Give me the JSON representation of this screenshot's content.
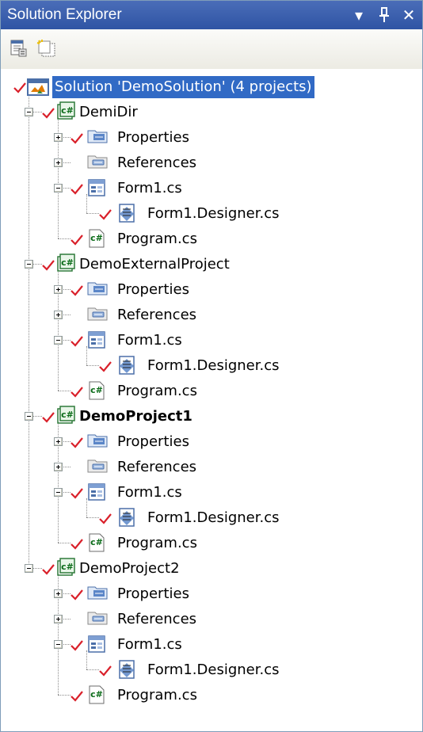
{
  "window": {
    "title": "Solution Explorer",
    "buttons": [
      {
        "name": "dropdown",
        "glyph": "▾"
      },
      {
        "name": "autohide-pin",
        "glyph": "ᵻ"
      },
      {
        "name": "close",
        "glyph": "✕"
      }
    ]
  },
  "toolbar": {
    "buttons": [
      {
        "name": "properties-button"
      },
      {
        "name": "show-all-files-button"
      }
    ]
  },
  "colors": {
    "selection": "#316ac5",
    "check": "#d9202a",
    "titlebar": "#3a5fae"
  },
  "tree": {
    "items": [
      {
        "label": "Solution 'DemoSolution' (4 projects)",
        "level": 0,
        "icon": "solution-icon",
        "expander": "none",
        "checked": true,
        "selected": true,
        "bold": false
      },
      {
        "label": "DemiDir",
        "level": 1,
        "icon": "csharp-project-icon",
        "expander": "minus",
        "checked": true,
        "bold": false
      },
      {
        "label": "Properties",
        "level": 2,
        "icon": "properties-icon",
        "expander": "plus",
        "checked": true
      },
      {
        "label": "References",
        "level": 2,
        "icon": "references-icon",
        "expander": "plus",
        "checked": false
      },
      {
        "label": "Form1.cs",
        "level": 2,
        "icon": "form-icon",
        "expander": "minus",
        "checked": true
      },
      {
        "label": "Form1.Designer.cs",
        "level": 3,
        "icon": "designer-icon",
        "expander": "none",
        "checked": true
      },
      {
        "label": "Program.cs",
        "level": 2,
        "icon": "csharp-file-icon",
        "expander": "none",
        "checked": true
      },
      {
        "label": "DemoExternalProject",
        "level": 1,
        "icon": "csharp-project-icon",
        "expander": "minus",
        "checked": true,
        "bold": false
      },
      {
        "label": "Properties",
        "level": 2,
        "icon": "properties-icon",
        "expander": "plus",
        "checked": true
      },
      {
        "label": "References",
        "level": 2,
        "icon": "references-icon",
        "expander": "plus",
        "checked": false
      },
      {
        "label": "Form1.cs",
        "level": 2,
        "icon": "form-icon",
        "expander": "minus",
        "checked": true
      },
      {
        "label": "Form1.Designer.cs",
        "level": 3,
        "icon": "designer-icon",
        "expander": "none",
        "checked": true
      },
      {
        "label": "Program.cs",
        "level": 2,
        "icon": "csharp-file-icon",
        "expander": "none",
        "checked": true
      },
      {
        "label": "DemoProject1",
        "level": 1,
        "icon": "csharp-project-icon",
        "expander": "minus",
        "checked": true,
        "bold": true
      },
      {
        "label": "Properties",
        "level": 2,
        "icon": "properties-icon",
        "expander": "plus",
        "checked": true
      },
      {
        "label": "References",
        "level": 2,
        "icon": "references-icon",
        "expander": "plus",
        "checked": false
      },
      {
        "label": "Form1.cs",
        "level": 2,
        "icon": "form-icon",
        "expander": "minus",
        "checked": true
      },
      {
        "label": "Form1.Designer.cs",
        "level": 3,
        "icon": "designer-icon",
        "expander": "none",
        "checked": true
      },
      {
        "label": "Program.cs",
        "level": 2,
        "icon": "csharp-file-icon",
        "expander": "none",
        "checked": true
      },
      {
        "label": "DemoProject2",
        "level": 1,
        "icon": "csharp-project-icon",
        "expander": "minus",
        "checked": true,
        "bold": false
      },
      {
        "label": "Properties",
        "level": 2,
        "icon": "properties-icon",
        "expander": "plus",
        "checked": true
      },
      {
        "label": "References",
        "level": 2,
        "icon": "references-icon",
        "expander": "plus",
        "checked": false
      },
      {
        "label": "Form1.cs",
        "level": 2,
        "icon": "form-icon",
        "expander": "minus",
        "checked": true
      },
      {
        "label": "Form1.Designer.cs",
        "level": 3,
        "icon": "designer-icon",
        "expander": "none",
        "checked": true
      },
      {
        "label": "Program.cs",
        "level": 2,
        "icon": "csharp-file-icon",
        "expander": "none",
        "checked": true
      }
    ]
  }
}
